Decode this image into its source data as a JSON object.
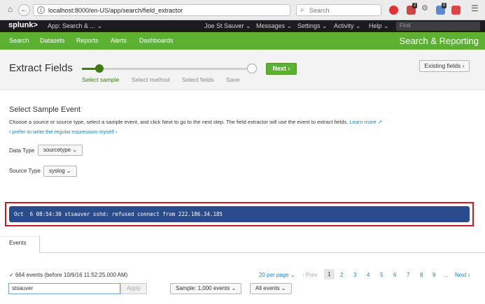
{
  "browser": {
    "url": "localhost:8000/en-US/app/search/field_extractor",
    "search_placeholder": "Search",
    "ext_badges": [
      "2",
      "0"
    ]
  },
  "splunk_bar": {
    "logo": "splunk>",
    "app": "App: Search & ...",
    "user": "Joe St Sauver",
    "messages": "Messages",
    "settings": "Settings",
    "activity": "Activity",
    "help": "Help",
    "find_placeholder": "Find"
  },
  "app_bar": {
    "nav": [
      "Search",
      "Datasets",
      "Reports",
      "Alerts",
      "Dashboards"
    ],
    "title": "Search & Reporting"
  },
  "header": {
    "title": "Extract Fields",
    "steps": [
      "Select sample",
      "Select method",
      "Select fields",
      "Save"
    ],
    "next_label": "Next",
    "existing_label": "Existing fields"
  },
  "content": {
    "section_title": "Select Sample Event",
    "description": "Choose a source or source type, select a sample event, and click Next to go to the next step. The field extractor will use the event to extract fields.",
    "learn_more": "Learn more",
    "regex_link": "I prefer to write the regular expression myself",
    "data_type_label": "Data Type",
    "data_type_value": "sourcetype",
    "source_type_label": "Source Type",
    "source_type_value": "syslog",
    "event_text": "Oct  6 08:54:30 stsauver sshd: refused connect from 222.186.34.185"
  },
  "events": {
    "tab_label": "Events",
    "count_text": "664 events (before 10/6/16 11:52:25.000 AM)",
    "per_page": "20 per page",
    "prev": "Prev",
    "pages": [
      "1",
      "2",
      "3",
      "4",
      "5",
      "6",
      "7",
      "8",
      "9"
    ],
    "current_page": "1",
    "ellipsis": "...",
    "next": "Next",
    "search_value": "stsauver",
    "apply_label": "Apply",
    "sample_label": "Sample: 1,000 events",
    "all_events_label": "All events"
  },
  "colors": {
    "splunk_green": "#5cb130",
    "step_active": "#3e7c12",
    "event_bg": "#2a4c8c",
    "highlight_border": "#c51d26"
  }
}
